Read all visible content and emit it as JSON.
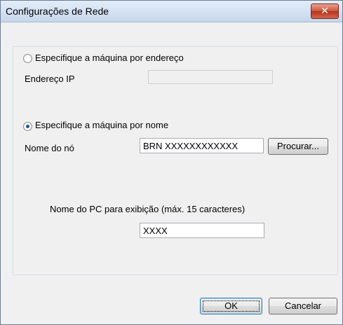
{
  "window": {
    "title": "Configurações de Rede"
  },
  "by_address": {
    "radio_label": "Especifique a máquina por endereço",
    "ip_label": "Endereço IP",
    "ip_value": ""
  },
  "by_name": {
    "radio_label": "Especifique a máquina por nome",
    "node_label": "Nome do nó",
    "node_value": "BRN XXXXXXXXXXXX",
    "browse_label": "Procurar..."
  },
  "display_name": {
    "label": "Nome do PC para exibição (máx. 15 caracteres)",
    "value": "XXXX"
  },
  "buttons": {
    "ok": "OK",
    "cancel": "Cancelar"
  },
  "icons": {
    "close": "close-icon"
  }
}
